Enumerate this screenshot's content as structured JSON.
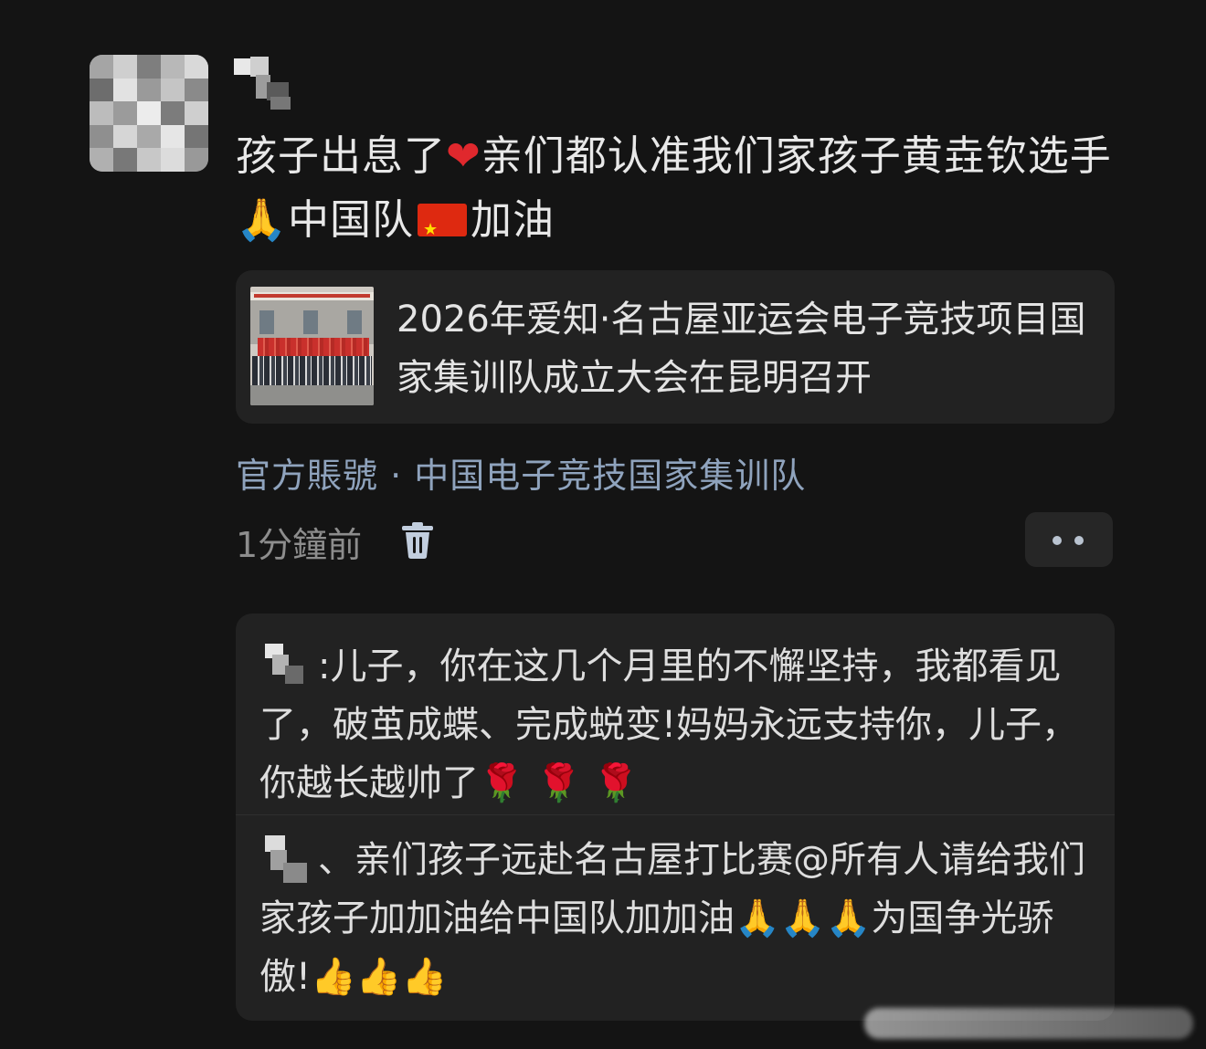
{
  "post": {
    "text": "孩子出息了❤️亲们都认准我们家孩子黄垚钦选手🙏中国队🇨🇳加油",
    "text_parts": [
      "孩子出息了",
      "❤",
      "亲们都认准我们家孩子黄垚钦选手",
      "🙏",
      "中国队",
      "加油"
    ]
  },
  "link_card": {
    "title": "2026年爱知·名古屋亚运会电子竞技项目国家集训队成立大会在昆明召开"
  },
  "account": "官方賬號 · 中国电子竞技国家集训队",
  "meta": {
    "time": "1分鐘前"
  },
  "icons": {
    "delete": "trash-icon",
    "more": "more-dots-icon"
  },
  "comments": [
    {
      "sep": ":",
      "text": "儿子，你在这几个月里的不懈坚持，我都看见了，破茧成蝶、完成蜕变!妈妈永远支持你，儿子，你越长越帅了",
      "emoji": "🌹 🌹 🌹"
    },
    {
      "sep": "、",
      "text": "亲们孩子远赴名古屋打比赛@所有人请给我们家孩子加加油给中国队加加油",
      "emoji_mid": "🙏🙏🙏",
      "text_after": "为国争光骄傲!",
      "emoji_end": "👍👍👍"
    }
  ],
  "colors": {
    "background": "#141414",
    "card": "#222222",
    "account_link": "#8fa3bd",
    "muted": "#8d8d8d"
  }
}
